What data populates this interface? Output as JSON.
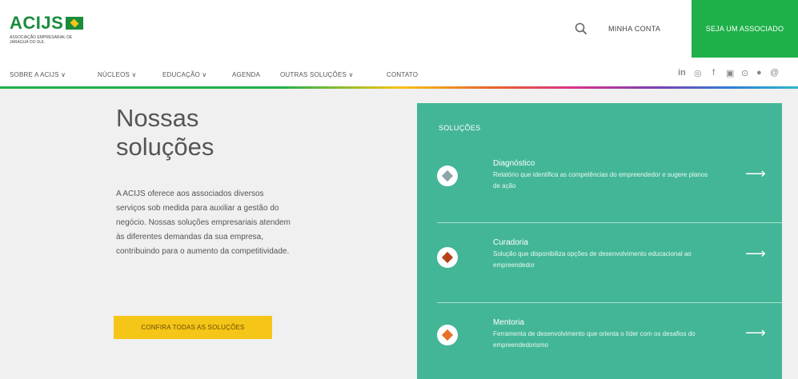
{
  "header": {
    "logo_text": "ACIJS",
    "logo_subtitle": "ASSOCIAÇÃO EMPRESARIAL DE JARAGUÁ DO SUL",
    "search_icon": "search-icon",
    "account_label": "MINHA CONTA",
    "member_cta": "SEJA UM ASSOCIADO"
  },
  "nav": {
    "items": [
      {
        "label": "SOBRE A ACIJS ∨"
      },
      {
        "label": "NÚCLEOS ∨"
      },
      {
        "label": "EDUCAÇÃO ∨"
      },
      {
        "label": "AGENDA"
      },
      {
        "label": "OUTRAS SOLUÇÕES ∨"
      },
      {
        "label": "CONTATO"
      }
    ],
    "social": [
      {
        "icon": "linkedin-icon",
        "glyph": "in"
      },
      {
        "icon": "instagram-icon",
        "glyph": "◎"
      },
      {
        "icon": "facebook-icon",
        "glyph": "f"
      },
      {
        "icon": "youtube-icon",
        "glyph": "▣"
      },
      {
        "icon": "flickr-icon",
        "glyph": "⊙"
      },
      {
        "icon": "spotify-icon",
        "glyph": "●"
      },
      {
        "icon": "threads-icon",
        "glyph": "@"
      }
    ]
  },
  "main": {
    "heading": "Nossas soluções",
    "lead": "A ACIJS oferece aos associados diversos serviços sob medida para auxiliar a gestão do negócio. Nossas soluções empresariais atendem às diferentes demandas da sua empresa, contribuindo para o aumento da competitividade.",
    "cta": "CONFIRA TODAS AS SOLUÇÕES"
  },
  "solutions": {
    "title": "SOLUÇÕES",
    "items": [
      {
        "title": "Diagnóstico",
        "desc": "Relatório que identifica as competências do empreendedor e sugere planos de ação",
        "color": "#8fa3a8"
      },
      {
        "title": "Curadoria",
        "desc": "Solução que disponibiliza opções de desenvolvimento educacional ao empreendedor",
        "color": "#b5431a"
      },
      {
        "title": "Mentoria",
        "desc": "Ferramenta de desenvolvimento que orienta o líder com os desafios do empreendedorismo",
        "color": "#e8702a"
      }
    ],
    "arrow_icon": "arrow-right-icon"
  }
}
